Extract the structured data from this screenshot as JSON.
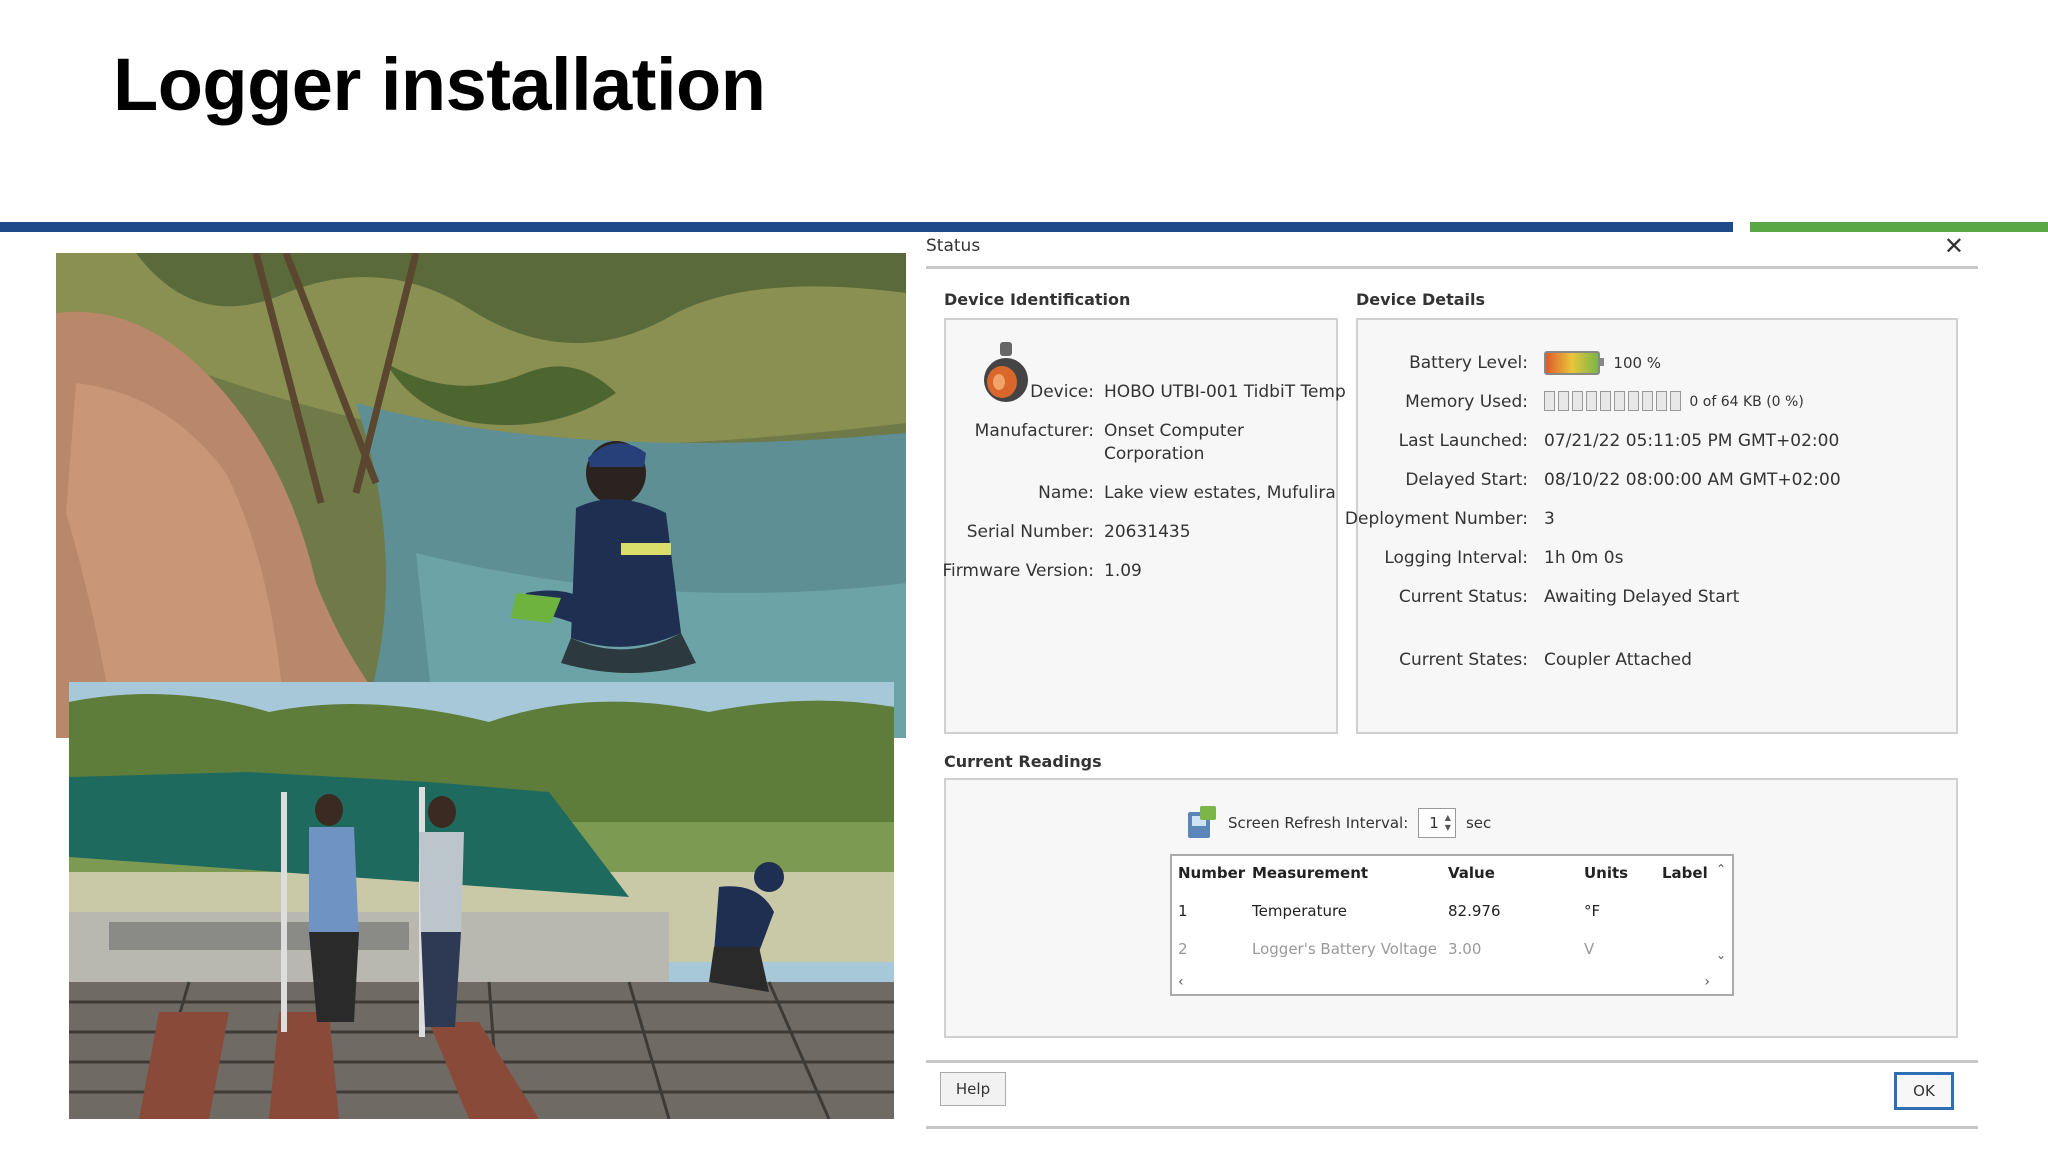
{
  "slide": {
    "title": "Logger installation"
  },
  "dialog": {
    "title": "Status",
    "close_icon": "close-icon",
    "device_identification": {
      "label": "Device Identification",
      "rows": [
        {
          "key": "Device:",
          "value": "HOBO UTBI-001 TidbiT Temp"
        },
        {
          "key": "Manufacturer:",
          "value": "Onset Computer",
          "value2": "Corporation"
        },
        {
          "key": "Name:",
          "value": "Lake view estates, Mufulira"
        },
        {
          "key": "Serial Number:",
          "value": "20631435"
        },
        {
          "key": "Firmware Version:",
          "value": "1.09"
        }
      ]
    },
    "device_details": {
      "label": "Device Details",
      "battery": {
        "key": "Battery Level:",
        "value": "100 %",
        "level_percent": 100
      },
      "memory": {
        "key": "Memory Used:",
        "value": "0 of 64 KB (0 %)",
        "used_percent": 0
      },
      "rows": [
        {
          "key": "Last Launched:",
          "value": "07/21/22 05:11:05 PM GMT+02:00"
        },
        {
          "key": "Delayed Start:",
          "value": "08/10/22 08:00:00 AM GMT+02:00"
        },
        {
          "key": "Deployment Number:",
          "value": "3"
        },
        {
          "key": "Logging Interval:",
          "value": "1h 0m 0s"
        },
        {
          "key": "Current Status:",
          "value": "Awaiting Delayed Start"
        },
        {
          "key": "Current States:",
          "value": "Coupler Attached"
        }
      ]
    },
    "current_readings": {
      "label": "Current Readings",
      "refresh_label": "Screen Refresh Interval:",
      "refresh_value": "1",
      "refresh_unit": "sec",
      "columns": [
        "Number",
        "Measurement",
        "Value",
        "Units",
        "Label"
      ],
      "rows": [
        {
          "number": "1",
          "measurement": "Temperature",
          "value": "82.976",
          "units": "°F"
        },
        {
          "number": "2",
          "measurement": "Logger's Battery Voltage",
          "value": "3.00",
          "units": "V"
        }
      ]
    },
    "buttons": {
      "help": "Help",
      "ok": "OK"
    }
  },
  "colors": {
    "title_bar_blue": "#1f4a8a",
    "title_bar_green": "#5aa845",
    "ok_border": "#2f6db5"
  }
}
